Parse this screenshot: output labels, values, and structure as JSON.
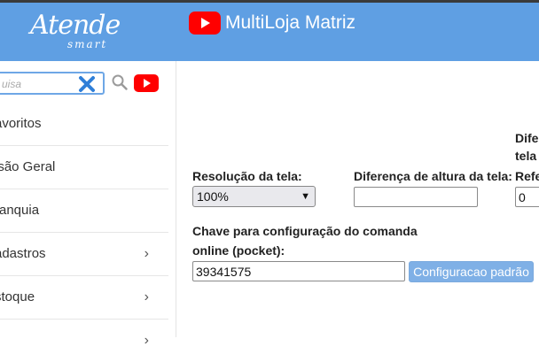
{
  "header": {
    "logo_text": "Atende",
    "logo_sub": "smart",
    "title": "MultiLoja Matriz",
    "youtube_icon": "youtube-icon",
    "background_color": "#5f9fe3"
  },
  "sidebar": {
    "search": {
      "placeholder": "uisa",
      "value": ""
    },
    "items": [
      {
        "label": "avoritos",
        "has_chevron": false
      },
      {
        "label": "isão Geral",
        "has_chevron": false
      },
      {
        "label": "ranquia",
        "has_chevron": false
      },
      {
        "label": "adastros",
        "has_chevron": true
      },
      {
        "label": "stoque",
        "has_chevron": true
      }
    ],
    "chevron": "›"
  },
  "main": {
    "resolution_label": "Resolução da tela:",
    "resolution_value": "100%",
    "height_diff_label": "Diferença de altura da tela:",
    "height_diff_value": "",
    "diff_label_line1": "Difer",
    "diff_label_line2": "tela",
    "diff_label_line3": "Refe",
    "diff_value": "0",
    "key_label_line1": "Chave para configuração do comanda",
    "key_label_line2": "online (pocket):",
    "key_value": "39341575",
    "default_button": "Configuracao padrão"
  }
}
